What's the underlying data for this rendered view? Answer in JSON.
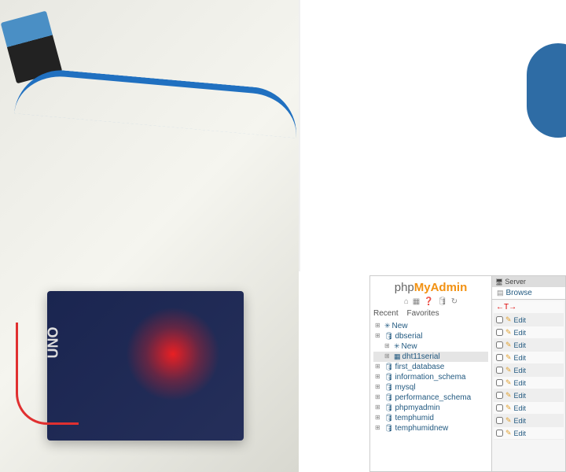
{
  "phpmyadmin": {
    "logo": {
      "php": "php",
      "my": "MyAdmin",
      "admin": ""
    },
    "toolbar_icons": [
      "home-icon",
      "sql-icon",
      "help-icon",
      "db-icon",
      "refresh-icon"
    ],
    "tabs": {
      "recent": "Recent",
      "favorites": "Favorites"
    },
    "tree": [
      {
        "label": "New",
        "depth": 0,
        "icon": "new",
        "selected": false
      },
      {
        "label": "dbserial",
        "depth": 0,
        "icon": "db",
        "selected": false
      },
      {
        "label": "New",
        "depth": 1,
        "icon": "new",
        "selected": false
      },
      {
        "label": "dht11serial",
        "depth": 1,
        "icon": "table",
        "selected": true
      },
      {
        "label": "first_database",
        "depth": 0,
        "icon": "db",
        "selected": false
      },
      {
        "label": "information_schema",
        "depth": 0,
        "icon": "db",
        "selected": false
      },
      {
        "label": "mysql",
        "depth": 0,
        "icon": "db",
        "selected": false
      },
      {
        "label": "performance_schema",
        "depth": 0,
        "icon": "db",
        "selected": false
      },
      {
        "label": "phpmyadmin",
        "depth": 0,
        "icon": "db",
        "selected": false
      },
      {
        "label": "temphumid",
        "depth": 0,
        "icon": "db",
        "selected": false
      },
      {
        "label": "temphumidnew",
        "depth": 0,
        "icon": "db",
        "selected": false
      }
    ],
    "server_label": "Server",
    "browse_label": "Browse",
    "new_row_label": "",
    "edit_label": "Edit",
    "row_count": 10
  }
}
